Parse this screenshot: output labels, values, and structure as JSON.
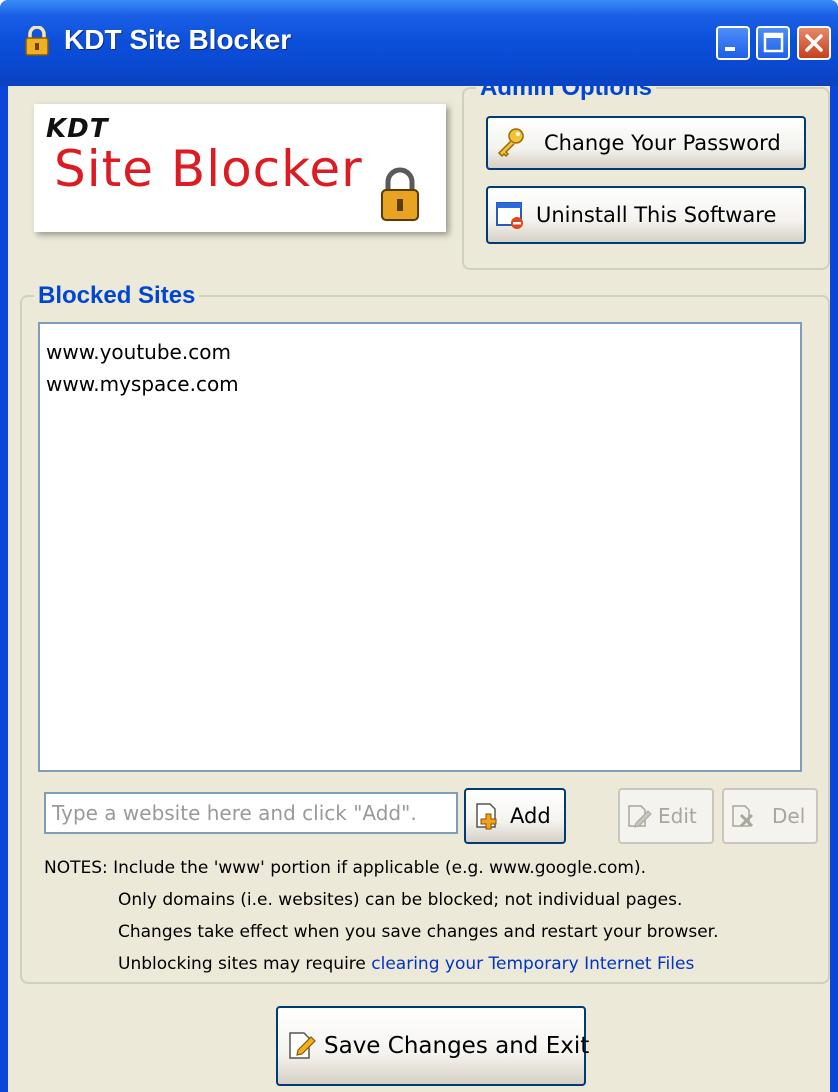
{
  "window": {
    "title": "KDT Site Blocker"
  },
  "logo": {
    "brand": "KDT",
    "product": "Site Blocker"
  },
  "admin": {
    "legend": "Admin Options",
    "change_password_label": "Change Your Password",
    "uninstall_label": "Uninstall This Software"
  },
  "blocked": {
    "legend": "Blocked Sites",
    "sites": [
      "www.youtube.com",
      "www.myspace.com"
    ],
    "input_placeholder": "Type a website here and click \"Add\".",
    "add_label": "Add",
    "edit_label": "Edit",
    "del_label": "Del"
  },
  "notes": {
    "line1": "NOTES: Include the 'www' portion if applicable (e.g. www.google.com).",
    "line2": "Only domains (i.e. websites) can be blocked; not individual pages.",
    "line3": "Changes take effect when you save changes and restart your browser.",
    "line4_text": "Unblocking sites may require ",
    "line4_link": "clearing your Temporary Internet Files"
  },
  "footer": {
    "save_label": "Save Changes and Exit"
  },
  "colors": {
    "title_bar": "#0b4fd9",
    "accent_text": "#0046d5",
    "logo_red": "#dd1b22",
    "link": "#0033cc"
  }
}
